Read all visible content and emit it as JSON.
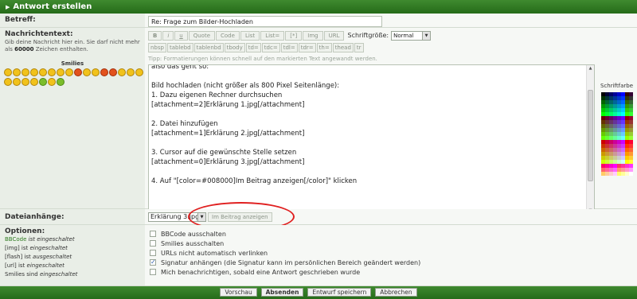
{
  "header": {
    "title": "Antwort erstellen"
  },
  "betreff": {
    "label": "Betreff:",
    "value": "Re: Frage zum Bilder-Hochladen"
  },
  "message": {
    "label": "Nachrichtentext:",
    "hint_pre": "Gib deine Nachricht hier ein. Sie darf nicht mehr als ",
    "hint_count": "60000",
    "hint_post": " Zeichen enthalten.",
    "smilies_title": "Smilies",
    "toolbar_row1": [
      "B",
      "i",
      "u",
      "Quote",
      "Code",
      "List",
      "List=",
      "[*]",
      "Img",
      "URL"
    ],
    "font_size_label": "Schriftgröße:",
    "font_size_value": "Normal",
    "toolbar_row2": [
      "nbsp",
      "tablebd",
      "tablenbd",
      "tbody",
      "td=",
      "tdc=",
      "tdl=",
      "tdr=",
      "th=",
      "thead",
      "tr"
    ],
    "tip": "Tipp: Formatierungen können schnell auf den markierten Text angewandt werden.",
    "text_lines": [
      "also das geht so:",
      "",
      "Bild hochladen (nicht größer als 800 Pixel Seitenlänge):",
      "1. Dazu eigenen Rechner durchsuchen",
      "[attachment=2]Erklärung 1.jpg[/attachment]",
      "",
      "2. Datei hinzufügen",
      "[attachment=1]Erklärung 2.jpg[/attachment]",
      "",
      "3. Cursor auf die gewünschte Stelle setzen",
      "[attachment=0]Erklärung 3.jpg[/attachment]",
      "",
      "4. Auf \"[color=#008000]Im Beitrag anzeigen[/color]\" klicken"
    ],
    "palette_title": "Schriftfarbe",
    "palette_colors": [
      "#000000",
      "#000033",
      "#000066",
      "#000099",
      "#0000cc",
      "#0000ff",
      "#330000",
      "#330033",
      "#003300",
      "#003333",
      "#003366",
      "#003399",
      "#0033cc",
      "#0033ff",
      "#333300",
      "#333333",
      "#006600",
      "#006633",
      "#006666",
      "#006699",
      "#0066cc",
      "#0066ff",
      "#336600",
      "#336633",
      "#009900",
      "#009933",
      "#009966",
      "#009999",
      "#0099cc",
      "#0099ff",
      "#339900",
      "#339933",
      "#00cc00",
      "#00cc33",
      "#00cc66",
      "#00cc99",
      "#00cccc",
      "#00ccff",
      "#33cc00",
      "#33cc33",
      "#00ff00",
      "#00ff33",
      "#00ff66",
      "#00ff99",
      "#00ffcc",
      "#00ffff",
      "#33ff00",
      "#33ff33",
      "#660000",
      "#660033",
      "#660066",
      "#660099",
      "#6600cc",
      "#6600ff",
      "#990000",
      "#990033",
      "#663300",
      "#663333",
      "#663366",
      "#663399",
      "#6633cc",
      "#6633ff",
      "#993300",
      "#993333",
      "#666600",
      "#666633",
      "#666666",
      "#666699",
      "#6666cc",
      "#6666ff",
      "#996600",
      "#996633",
      "#669900",
      "#669933",
      "#669966",
      "#669999",
      "#6699cc",
      "#6699ff",
      "#999900",
      "#999933",
      "#66cc00",
      "#66cc33",
      "#66cc66",
      "#66cc99",
      "#66cccc",
      "#66ccff",
      "#99cc00",
      "#99cc33",
      "#66ff00",
      "#66ff33",
      "#66ff66",
      "#66ff99",
      "#66ffcc",
      "#66ffff",
      "#99ff00",
      "#99ff33",
      "#cc0000",
      "#cc0033",
      "#cc0066",
      "#cc0099",
      "#cc00cc",
      "#cc00ff",
      "#ff0000",
      "#ff0033",
      "#cc3300",
      "#cc3333",
      "#cc3366",
      "#cc3399",
      "#cc33cc",
      "#cc33ff",
      "#ff3300",
      "#ff3333",
      "#cc6600",
      "#cc6633",
      "#cc6666",
      "#cc6699",
      "#cc66cc",
      "#cc66ff",
      "#ff6600",
      "#ff6633",
      "#cc9900",
      "#cc9933",
      "#cc9966",
      "#cc9999",
      "#cc99cc",
      "#cc99ff",
      "#ff9900",
      "#ff9933",
      "#cccc00",
      "#cccc33",
      "#cccc66",
      "#cccc99",
      "#cccccc",
      "#ccccff",
      "#ffcc00",
      "#ffcc33",
      "#ccff00",
      "#ccff33",
      "#ccff66",
      "#ccff99",
      "#ccffcc",
      "#ccffff",
      "#ffff00",
      "#ffff33",
      "#ff0066",
      "#ff0099",
      "#ff00cc",
      "#ff00ff",
      "#ff3366",
      "#ff3399",
      "#ff33cc",
      "#ff33ff",
      "#ff6666",
      "#ff6699",
      "#ff66cc",
      "#ff66ff",
      "#ff9966",
      "#ff9999",
      "#ff99cc",
      "#ff99ff",
      "#ffcc66",
      "#ffcc99",
      "#ffcccc",
      "#ffccff",
      "#ffff66",
      "#ffff99",
      "#ffffcc",
      "#ffffff"
    ]
  },
  "attachments": {
    "label": "Dateianhänge:",
    "selected": "Erklärung 3.jpg",
    "show_button": "Im Beitrag anzeigen"
  },
  "options": {
    "label": "Optionen:",
    "status": [
      {
        "pre": "",
        "hl": "BBCode",
        "post": " ist eingeschaltet"
      },
      {
        "pre": "[img] ist ",
        "hl": "",
        "post": "eingeschaltet"
      },
      {
        "pre": "[flash] ist ",
        "hl": "",
        "post": "ausgeschaltet"
      },
      {
        "pre": "[url] ist ",
        "hl": "",
        "post": "eingeschaltet"
      },
      {
        "pre": "Smilies sind ",
        "hl": "",
        "post": "eingeschaltet"
      }
    ],
    "checkboxes": [
      {
        "label": "BBCode ausschalten",
        "checked": false
      },
      {
        "label": "Smilies ausschalten",
        "checked": false
      },
      {
        "label": "URLs nicht automatisch verlinken",
        "checked": false
      },
      {
        "label": "Signatur anhängen (die Signatur kann im persönlichen Bereich geändert werden)",
        "checked": true
      },
      {
        "label": "Mich benachrichtigen, sobald eine Antwort geschrieben wurde",
        "checked": false
      }
    ]
  },
  "footer": {
    "preview": "Vorschau",
    "submit": "Absenden",
    "save_draft": "Entwurf speichern",
    "cancel": "Abbrechen"
  }
}
